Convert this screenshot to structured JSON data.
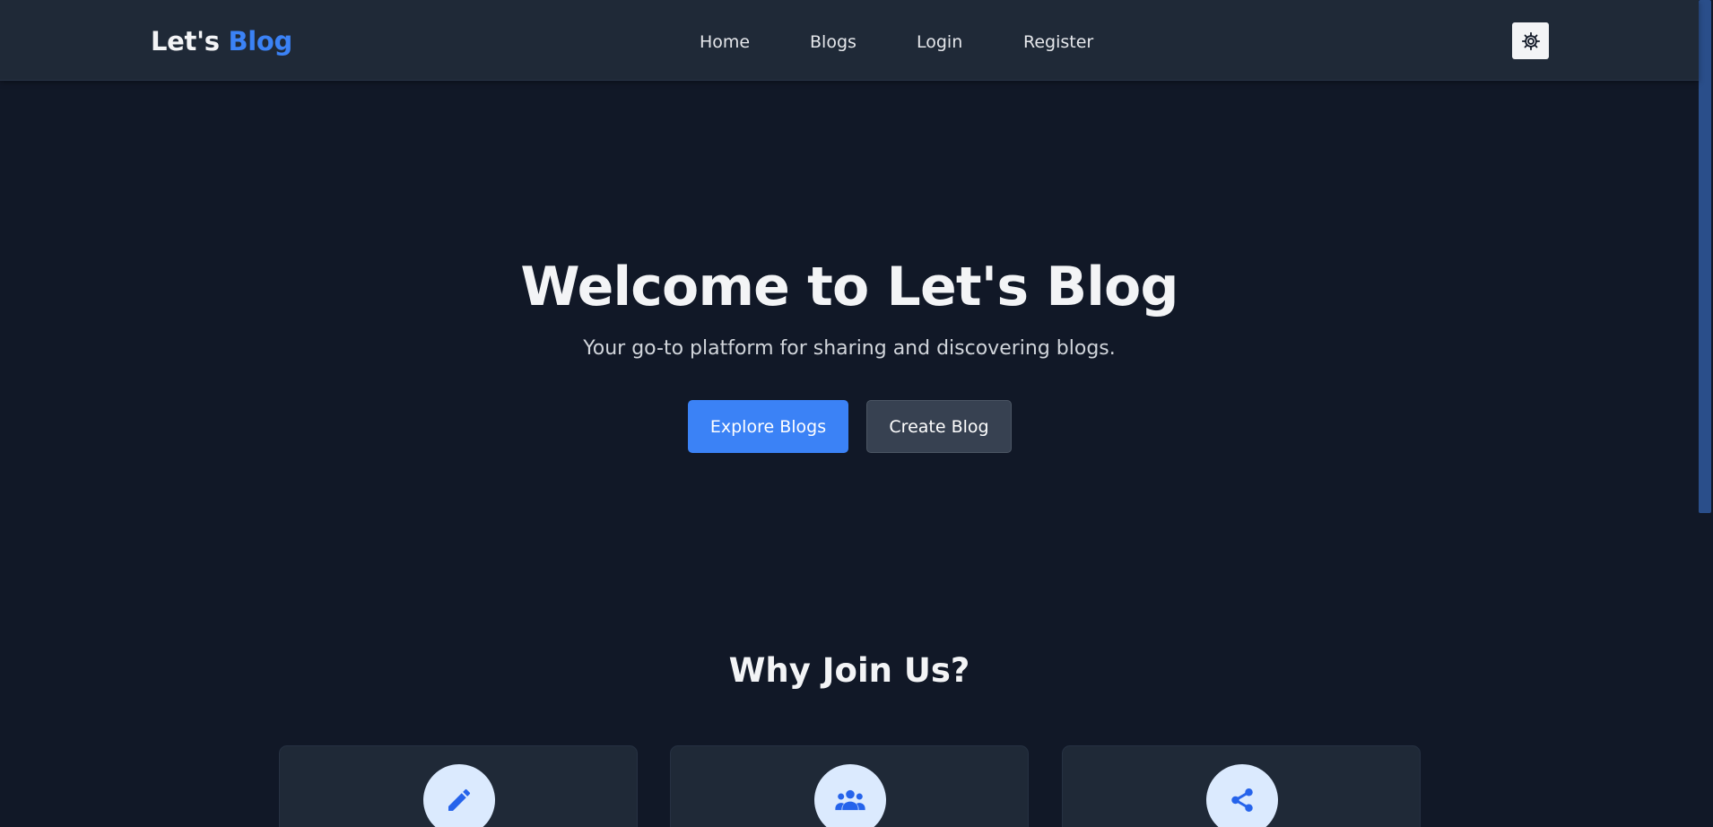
{
  "header": {
    "brand_part1": "Let's ",
    "brand_part2": "Blog",
    "nav": [
      {
        "label": "Home"
      },
      {
        "label": "Blogs"
      },
      {
        "label": "Login"
      },
      {
        "label": "Register"
      }
    ],
    "theme_toggle_icon": "gear-icon"
  },
  "hero": {
    "title": "Welcome to Let's Blog",
    "subtitle": "Your go-to platform for sharing and discovering blogs.",
    "primary_button": "Explore Blogs",
    "secondary_button": "Create Blog"
  },
  "features": {
    "title": "Why Join Us?",
    "cards": [
      {
        "icon": "pencil-icon"
      },
      {
        "icon": "users-icon"
      },
      {
        "icon": "share-icon"
      }
    ]
  },
  "colors": {
    "background": "#111827",
    "navbar": "#1f2937",
    "accent": "#3b82f6",
    "secondary_button": "#374151",
    "icon_circle": "#dbeafe"
  }
}
